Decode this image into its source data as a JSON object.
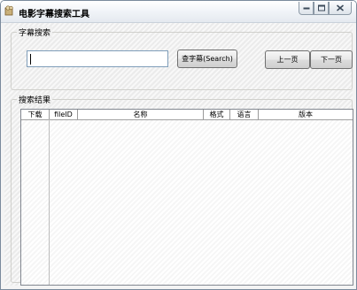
{
  "window": {
    "title": "电影字幕搜索工具",
    "icons": {
      "app": "app-icon",
      "minimize": "minimize-icon",
      "maximize": "maximize-icon",
      "close": "close-icon"
    }
  },
  "search_group": {
    "label": "字幕搜索",
    "input_value": "",
    "search_button": "查字幕(Search)",
    "prev_button": "上一页",
    "next_button": "下一页"
  },
  "results_group": {
    "label": "搜索结果",
    "columns": [
      "下载",
      "fileID",
      "名称",
      "格式",
      "语言",
      "版本"
    ],
    "rows": []
  }
}
